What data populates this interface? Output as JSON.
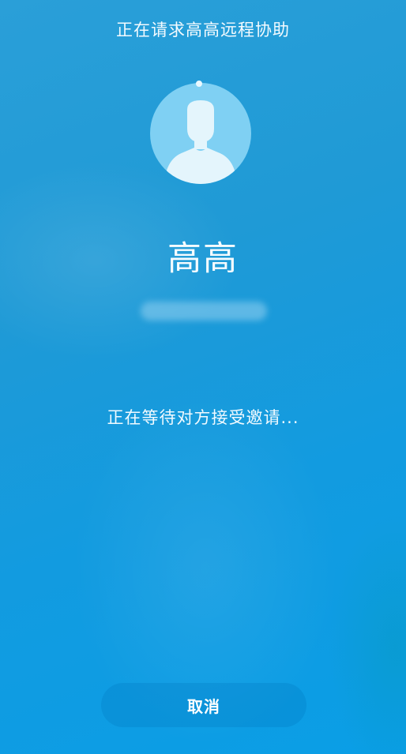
{
  "header": {
    "title": "正在请求高高远程协助"
  },
  "contact": {
    "name": "高高",
    "avatar_icon": "person-silhouette-icon"
  },
  "status": {
    "text": "正在等待对方接受邀请..."
  },
  "actions": {
    "cancel_label": "取消"
  },
  "colors": {
    "background": "#1f9ad6",
    "avatar_bg": "#7fd0f3",
    "avatar_figure": "#e4f5fc",
    "text": "#f4fbff"
  }
}
